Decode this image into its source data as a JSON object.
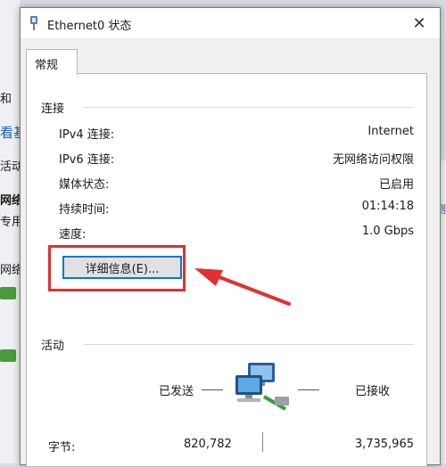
{
  "background": {
    "fragments": [
      "和",
      "看基",
      "活动",
      "网络",
      "专用",
      "网络"
    ],
    "right_fragment": "出测"
  },
  "window": {
    "title": "Ethernet0 状态",
    "close_glyph": "✕"
  },
  "tabs": [
    {
      "label": "常规"
    }
  ],
  "connection": {
    "heading": "连接",
    "rows": [
      {
        "label": "IPv4 连接:",
        "value": "Internet"
      },
      {
        "label": "IPv6 连接:",
        "value": "无网络访问权限"
      },
      {
        "label": "媒体状态:",
        "value": "已启用"
      },
      {
        "label": "持续时间:",
        "value": "01:14:18"
      },
      {
        "label": "速度:",
        "value": "1.0 Gbps"
      }
    ],
    "details_button": "详细信息(E)..."
  },
  "activity": {
    "heading": "活动",
    "sent_label": "已发送",
    "received_label": "已接收",
    "bytes_label": "字节:",
    "bytes_sent": "820,782",
    "bytes_received": "3,735,965"
  },
  "colors": {
    "annotation": "#e03030",
    "focus": "#0078d7"
  },
  "icons": {
    "title": "ethernet-icon",
    "activity": "network-computers-icon",
    "annotation": "red-arrow-icon"
  }
}
